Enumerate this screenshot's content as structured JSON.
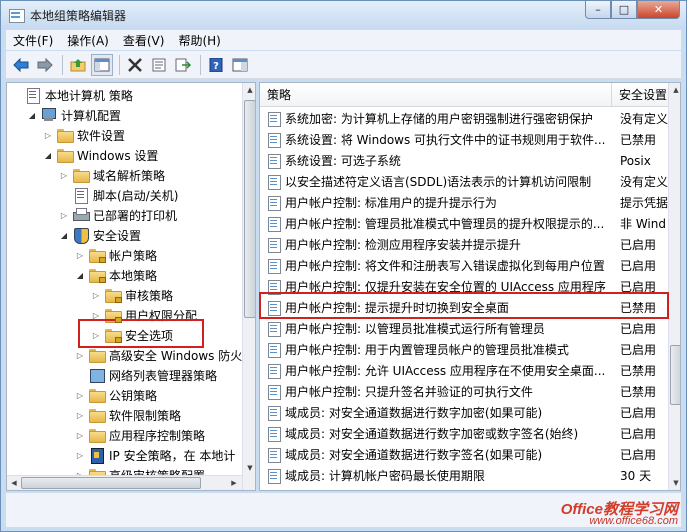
{
  "window": {
    "title": "本地组策略编辑器",
    "buttons": {
      "minimize": "–",
      "maximize": "□",
      "close": "✕"
    }
  },
  "menu": [
    "文件(F)",
    "操作(A)",
    "查看(V)",
    "帮助(H)"
  ],
  "toolbar": {
    "buttons": [
      "back-arrow-icon",
      "forward-arrow-icon",
      "up-folder-icon",
      "show-hide-tree-icon",
      "delete-icon",
      "properties-icon",
      "export-icon",
      "help-icon",
      "console-icon"
    ]
  },
  "tree": [
    {
      "label": "本地计算机 策略",
      "icon": "doc",
      "arrow": "",
      "indent": 0
    },
    {
      "label": "计算机配置",
      "icon": "computer",
      "arrow": "open",
      "indent": 1
    },
    {
      "label": "软件设置",
      "icon": "folder",
      "arrow": "closed",
      "indent": 2
    },
    {
      "label": "Windows 设置",
      "icon": "folder",
      "arrow": "open",
      "indent": 2
    },
    {
      "label": "域名解析策略",
      "icon": "folder",
      "arrow": "closed",
      "indent": 3
    },
    {
      "label": "脚本(启动/关机)",
      "icon": "doc",
      "arrow": "",
      "indent": 3
    },
    {
      "label": "已部署的打印机",
      "icon": "printer",
      "arrow": "closed",
      "indent": 3
    },
    {
      "label": "安全设置",
      "icon": "shield",
      "arrow": "open",
      "indent": 3
    },
    {
      "label": "帐户策略",
      "icon": "lockfolder",
      "arrow": "closed",
      "indent": 4
    },
    {
      "label": "本地策略",
      "icon": "lockfolder",
      "arrow": "open",
      "indent": 4
    },
    {
      "label": "审核策略",
      "icon": "lockfolder",
      "arrow": "closed",
      "indent": 5
    },
    {
      "label": "用户权限分配",
      "icon": "lockfolder",
      "arrow": "closed",
      "indent": 5
    },
    {
      "label": "安全选项",
      "icon": "lockfolder",
      "arrow": "closed",
      "indent": 5
    },
    {
      "label": "高级安全 Windows 防火",
      "icon": "folder",
      "arrow": "closed",
      "indent": 4
    },
    {
      "label": "网络列表管理器策略",
      "icon": "netpolicy",
      "arrow": "",
      "indent": 4
    },
    {
      "label": "公钥策略",
      "icon": "folder",
      "arrow": "closed",
      "indent": 4
    },
    {
      "label": "软件限制策略",
      "icon": "folder",
      "arrow": "closed",
      "indent": 4
    },
    {
      "label": "应用程序控制策略",
      "icon": "folder",
      "arrow": "closed",
      "indent": 4
    },
    {
      "label": "IP 安全策略，在 本地计",
      "icon": "ipsec",
      "arrow": "closed",
      "indent": 4
    },
    {
      "label": "高级审核策略配置",
      "icon": "folder",
      "arrow": "closed",
      "indent": 4
    }
  ],
  "list": {
    "columns": [
      "策略",
      "安全设置"
    ],
    "rows": [
      {
        "policy": "系统加密: 为计算机上存储的用户密钥强制进行强密钥保护",
        "setting": "没有定义"
      },
      {
        "policy": "系统设置: 将 Windows 可执行文件中的证书规则用于软件...",
        "setting": "已禁用"
      },
      {
        "policy": "系统设置: 可选子系统",
        "setting": "Posix"
      },
      {
        "policy": "以安全描述符定义语言(SDDL)语法表示的计算机访问限制",
        "setting": "没有定义"
      },
      {
        "policy": "用户帐户控制: 标准用户的提升提示行为",
        "setting": "提示凭据"
      },
      {
        "policy": "用户帐户控制: 管理员批准模式中管理员的提升权限提示的...",
        "setting": "非 Wind"
      },
      {
        "policy": "用户帐户控制: 检测应用程序安装并提示提升",
        "setting": "已启用"
      },
      {
        "policy": "用户帐户控制: 将文件和注册表写入错误虚拟化到每用户位置",
        "setting": "已启用"
      },
      {
        "policy": "用户帐户控制: 仅提升安装在安全位置的 UIAccess 应用程序",
        "setting": "已启用"
      },
      {
        "policy": "用户帐户控制: 提示提升时切换到安全桌面",
        "setting": "已禁用"
      },
      {
        "policy": "用户帐户控制: 以管理员批准模式运行所有管理员",
        "setting": "已启用"
      },
      {
        "policy": "用户帐户控制: 用于内置管理员帐户的管理员批准模式",
        "setting": "已启用"
      },
      {
        "policy": "用户帐户控制: 允许 UIAccess 应用程序在不使用安全桌面...",
        "setting": "已禁用"
      },
      {
        "policy": "用户帐户控制: 只提升签名并验证的可执行文件",
        "setting": "已禁用"
      },
      {
        "policy": "域成员: 对安全通道数据进行数字加密(如果可能)",
        "setting": "已启用"
      },
      {
        "policy": "域成员: 对安全通道数据进行数字加密或数字签名(始终)",
        "setting": "已启用"
      },
      {
        "policy": "域成员: 对安全通道数据进行数字签名(如果可能)",
        "setting": "已启用"
      },
      {
        "policy": "域成员: 计算机帐户密码最长使用期限",
        "setting": "30 天"
      }
    ]
  },
  "watermark": {
    "title": "Office教程学习网",
    "url": "www.office68.com"
  }
}
